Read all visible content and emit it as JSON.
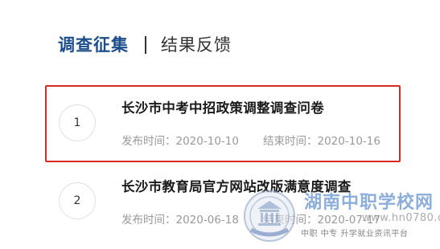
{
  "tabs": {
    "active_label": "调查征集",
    "inactive_label": "结果反馈"
  },
  "surveys": [
    {
      "number": "1",
      "title": "长沙市中考中招政策调整调查问卷",
      "publish_label": "发布时间：",
      "publish_date": "2020-10-10",
      "end_label": "结束时间：",
      "end_date": "2020-10-16"
    },
    {
      "number": "2",
      "title": "长沙市教育局官方网站改版满意度调查",
      "publish_label": "发布时间：",
      "publish_date": "2020-06-18",
      "end_label": "结束时间：",
      "end_date": "2020-07-17"
    }
  ],
  "watermark": {
    "title": "湖南中职学校网",
    "url": "www.hn0780.cn",
    "slogan": "中职 中专 升学就业资讯平台"
  },
  "colors": {
    "active_tab": "#1d4e8c",
    "highlight_border": "#d42b25",
    "meta_text": "#999999"
  }
}
